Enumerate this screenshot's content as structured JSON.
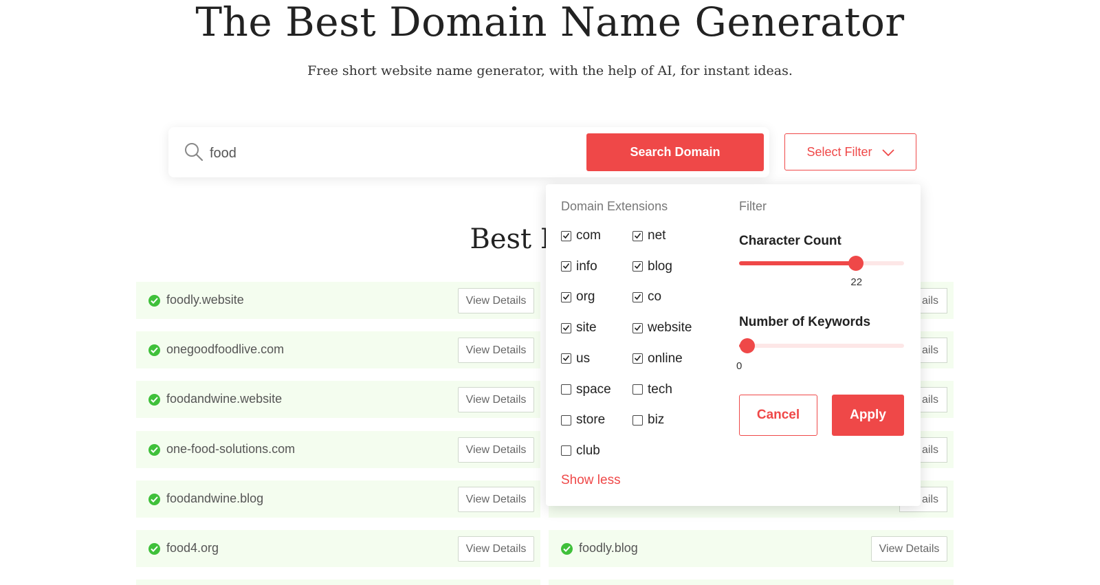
{
  "header": {
    "title": "The Best Domain Name Generator",
    "subtitle": "Free short website name generator, with the help of AI, for instant ideas."
  },
  "search": {
    "value": "food",
    "button_label": "Search Domain"
  },
  "filter_button": {
    "label": "Select Filter"
  },
  "results": {
    "section_title": "Best Domai",
    "view_details_label": "View Details",
    "partial_label": "ails",
    "left": [
      "foodly.website",
      "onegoodfoodlive.com",
      "foodandwine.website",
      "one-food-solutions.com",
      "foodandwine.blog",
      "food4.org"
    ],
    "right_last": "foodly.blog"
  },
  "filter_panel": {
    "extensions_heading": "Domain Extensions",
    "filter_heading": "Filter",
    "extensions": [
      {
        "label": "com",
        "checked": true
      },
      {
        "label": "net",
        "checked": true
      },
      {
        "label": "info",
        "checked": true
      },
      {
        "label": "blog",
        "checked": true
      },
      {
        "label": "org",
        "checked": true
      },
      {
        "label": "co",
        "checked": true
      },
      {
        "label": "site",
        "checked": true
      },
      {
        "label": "website",
        "checked": true
      },
      {
        "label": "us",
        "checked": true
      },
      {
        "label": "online",
        "checked": true
      },
      {
        "label": "space",
        "checked": false
      },
      {
        "label": "tech",
        "checked": false
      },
      {
        "label": "store",
        "checked": false
      },
      {
        "label": "biz",
        "checked": false
      },
      {
        "label": "club",
        "checked": false
      }
    ],
    "show_less_label": "Show less",
    "character_count": {
      "label": "Character Count",
      "value": "22",
      "fraction": 0.71
    },
    "keywords": {
      "label": "Number of Keywords",
      "value": "0",
      "fraction": 0.05
    },
    "cancel_label": "Cancel",
    "apply_label": "Apply"
  },
  "colors": {
    "accent": "#ef4848",
    "row_bg": "#f4fdef",
    "check": "#3fc03a"
  }
}
